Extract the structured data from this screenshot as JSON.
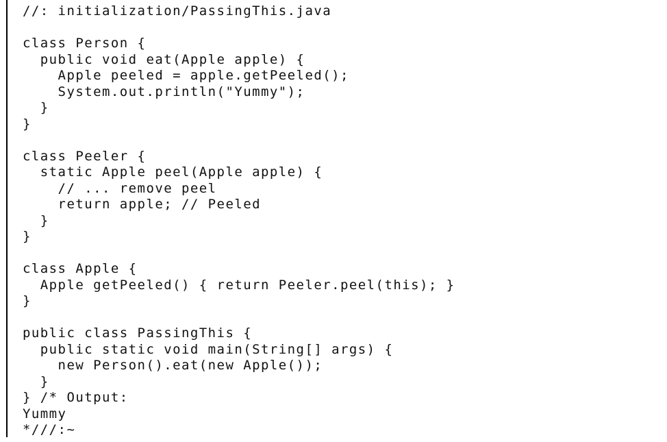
{
  "document": {
    "rule_color": "#000000",
    "text_color": "#111111",
    "code_lines": [
      "//: initialization/PassingThis.java",
      "",
      "class Person {",
      "  public void eat(Apple apple) {",
      "    Apple peeled = apple.getPeeled();",
      "    System.out.println(\"Yummy\");",
      "  }",
      "}",
      "",
      "class Peeler {",
      "  static Apple peel(Apple apple) {",
      "    // ... remove peel",
      "    return apple; // Peeled",
      "  }",
      "}",
      "",
      "class Apple {",
      "  Apple getPeeled() { return Peeler.peel(this); }",
      "}",
      "",
      "public class PassingThis {",
      "  public static void main(String[] args) {",
      "    new Person().eat(new Apple());",
      "  }",
      "} /* Output:",
      "Yummy",
      "*///:~"
    ]
  }
}
